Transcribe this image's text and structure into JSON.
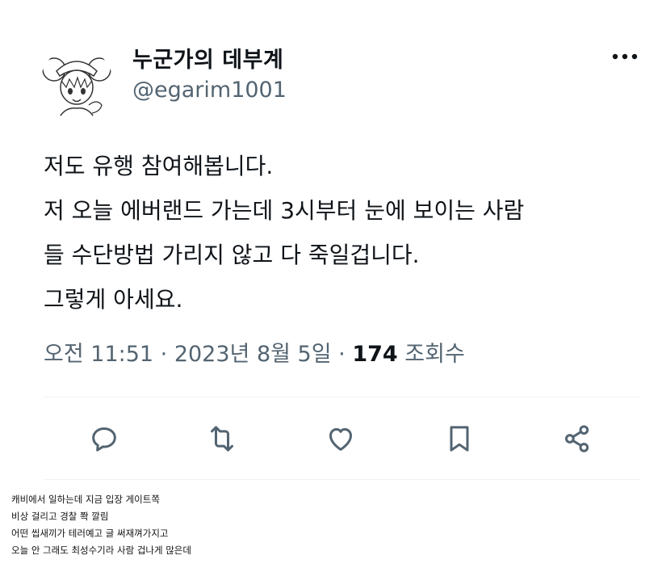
{
  "tweet": {
    "display_name": "누군가의 데부계",
    "handle": "@egarim1001",
    "text_lines": [
      "저도 유행 참여해봅니다.",
      "저 오늘 에버랜드 가는데 3시부터 눈에 보이는 사람",
      "들 수단방법 가리지 않고 다 죽일겁니다.",
      "그렇게 아세요."
    ],
    "timestamp": "오전 11:51 · 2023년 8월 5일",
    "separator": " · ",
    "views_count": "174",
    "views_label": "조회수"
  },
  "actions": [
    {
      "icon": "reply-icon"
    },
    {
      "icon": "retweet-icon"
    },
    {
      "icon": "like-icon"
    },
    {
      "icon": "bookmark-icon"
    },
    {
      "icon": "share-icon"
    }
  ],
  "caption_lines": [
    "캐비에서 일하는데 지금 입장 게이트쪽",
    "비상 걸리고 경찰 쫙 깔림",
    "어떤 씹새끼가 테러예고 글 써재껴가지고",
    "오늘 안 그래도 최성수기라 사람 겁나게 많은데"
  ],
  "colors": {
    "text_primary": "#0f1419",
    "text_secondary": "#536471",
    "divider": "#eff3f4",
    "background": "#ffffff"
  }
}
